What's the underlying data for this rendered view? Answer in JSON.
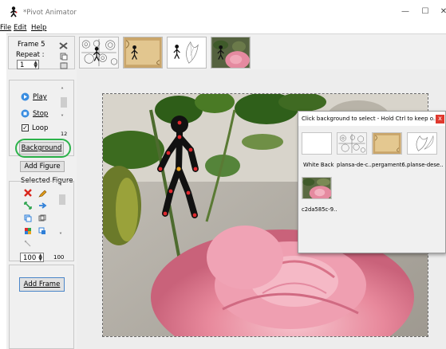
{
  "window": {
    "title": "*Pivot Animator",
    "controls": [
      "—",
      "☐",
      "✕"
    ]
  },
  "menu": {
    "file": "File",
    "edit": "Edit",
    "help": "Help"
  },
  "frame_panel": {
    "frame_label": "Frame 5",
    "repeat_label": "Repeat :",
    "repeat_value": "1"
  },
  "playback": {
    "play": "Play",
    "stop": "Stop",
    "loop": "Loop",
    "loop_checked": true,
    "speed_value": "12",
    "background": "Background",
    "add_figure": "Add Figure"
  },
  "selected_figure": {
    "heading": "Selected Figure",
    "scale_min_value": "100",
    "scale_value": "100",
    "colors": {
      "delete": "#d9261c",
      "edit": "#e09b19",
      "blue": "#2f7fd8",
      "green": "#2ea44f"
    }
  },
  "add_frame": "Add Frame",
  "dialog": {
    "title": "Click background to select - Hold Ctrl to keep o...",
    "close": "x",
    "options": [
      {
        "label": "White Back"
      },
      {
        "label": "plansa-de-c.."
      },
      {
        "label": "pergament6.."
      },
      {
        "label": "planse-dese.."
      },
      {
        "label": "c2da585c-9.."
      }
    ]
  },
  "colors": {
    "accent_circle": "#2bb34a",
    "figure_body": "#111111",
    "figure_joint": "#e0292e",
    "figure_root": "#e9a320",
    "dialog_close_bg": "#e0392e"
  }
}
